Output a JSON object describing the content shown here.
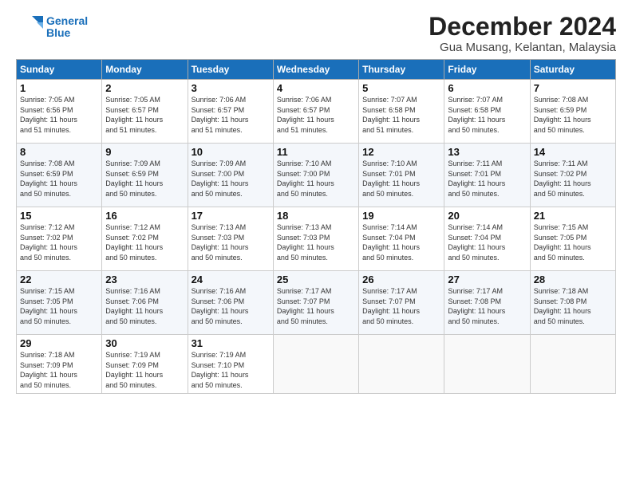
{
  "logo": {
    "text_general": "General",
    "text_blue": "Blue"
  },
  "title": "December 2024",
  "subtitle": "Gua Musang, Kelantan, Malaysia",
  "days_of_week": [
    "Sunday",
    "Monday",
    "Tuesday",
    "Wednesday",
    "Thursday",
    "Friday",
    "Saturday"
  ],
  "weeks": [
    [
      {
        "day": "1",
        "info": "Sunrise: 7:05 AM\nSunset: 6:56 PM\nDaylight: 11 hours\nand 51 minutes."
      },
      {
        "day": "2",
        "info": "Sunrise: 7:05 AM\nSunset: 6:57 PM\nDaylight: 11 hours\nand 51 minutes."
      },
      {
        "day": "3",
        "info": "Sunrise: 7:06 AM\nSunset: 6:57 PM\nDaylight: 11 hours\nand 51 minutes."
      },
      {
        "day": "4",
        "info": "Sunrise: 7:06 AM\nSunset: 6:57 PM\nDaylight: 11 hours\nand 51 minutes."
      },
      {
        "day": "5",
        "info": "Sunrise: 7:07 AM\nSunset: 6:58 PM\nDaylight: 11 hours\nand 51 minutes."
      },
      {
        "day": "6",
        "info": "Sunrise: 7:07 AM\nSunset: 6:58 PM\nDaylight: 11 hours\nand 50 minutes."
      },
      {
        "day": "7",
        "info": "Sunrise: 7:08 AM\nSunset: 6:59 PM\nDaylight: 11 hours\nand 50 minutes."
      }
    ],
    [
      {
        "day": "8",
        "info": "Sunrise: 7:08 AM\nSunset: 6:59 PM\nDaylight: 11 hours\nand 50 minutes."
      },
      {
        "day": "9",
        "info": "Sunrise: 7:09 AM\nSunset: 6:59 PM\nDaylight: 11 hours\nand 50 minutes."
      },
      {
        "day": "10",
        "info": "Sunrise: 7:09 AM\nSunset: 7:00 PM\nDaylight: 11 hours\nand 50 minutes."
      },
      {
        "day": "11",
        "info": "Sunrise: 7:10 AM\nSunset: 7:00 PM\nDaylight: 11 hours\nand 50 minutes."
      },
      {
        "day": "12",
        "info": "Sunrise: 7:10 AM\nSunset: 7:01 PM\nDaylight: 11 hours\nand 50 minutes."
      },
      {
        "day": "13",
        "info": "Sunrise: 7:11 AM\nSunset: 7:01 PM\nDaylight: 11 hours\nand 50 minutes."
      },
      {
        "day": "14",
        "info": "Sunrise: 7:11 AM\nSunset: 7:02 PM\nDaylight: 11 hours\nand 50 minutes."
      }
    ],
    [
      {
        "day": "15",
        "info": "Sunrise: 7:12 AM\nSunset: 7:02 PM\nDaylight: 11 hours\nand 50 minutes."
      },
      {
        "day": "16",
        "info": "Sunrise: 7:12 AM\nSunset: 7:02 PM\nDaylight: 11 hours\nand 50 minutes."
      },
      {
        "day": "17",
        "info": "Sunrise: 7:13 AM\nSunset: 7:03 PM\nDaylight: 11 hours\nand 50 minutes."
      },
      {
        "day": "18",
        "info": "Sunrise: 7:13 AM\nSunset: 7:03 PM\nDaylight: 11 hours\nand 50 minutes."
      },
      {
        "day": "19",
        "info": "Sunrise: 7:14 AM\nSunset: 7:04 PM\nDaylight: 11 hours\nand 50 minutes."
      },
      {
        "day": "20",
        "info": "Sunrise: 7:14 AM\nSunset: 7:04 PM\nDaylight: 11 hours\nand 50 minutes."
      },
      {
        "day": "21",
        "info": "Sunrise: 7:15 AM\nSunset: 7:05 PM\nDaylight: 11 hours\nand 50 minutes."
      }
    ],
    [
      {
        "day": "22",
        "info": "Sunrise: 7:15 AM\nSunset: 7:05 PM\nDaylight: 11 hours\nand 50 minutes."
      },
      {
        "day": "23",
        "info": "Sunrise: 7:16 AM\nSunset: 7:06 PM\nDaylight: 11 hours\nand 50 minutes."
      },
      {
        "day": "24",
        "info": "Sunrise: 7:16 AM\nSunset: 7:06 PM\nDaylight: 11 hours\nand 50 minutes."
      },
      {
        "day": "25",
        "info": "Sunrise: 7:17 AM\nSunset: 7:07 PM\nDaylight: 11 hours\nand 50 minutes."
      },
      {
        "day": "26",
        "info": "Sunrise: 7:17 AM\nSunset: 7:07 PM\nDaylight: 11 hours\nand 50 minutes."
      },
      {
        "day": "27",
        "info": "Sunrise: 7:17 AM\nSunset: 7:08 PM\nDaylight: 11 hours\nand 50 minutes."
      },
      {
        "day": "28",
        "info": "Sunrise: 7:18 AM\nSunset: 7:08 PM\nDaylight: 11 hours\nand 50 minutes."
      }
    ],
    [
      {
        "day": "29",
        "info": "Sunrise: 7:18 AM\nSunset: 7:09 PM\nDaylight: 11 hours\nand 50 minutes."
      },
      {
        "day": "30",
        "info": "Sunrise: 7:19 AM\nSunset: 7:09 PM\nDaylight: 11 hours\nand 50 minutes."
      },
      {
        "day": "31",
        "info": "Sunrise: 7:19 AM\nSunset: 7:10 PM\nDaylight: 11 hours\nand 50 minutes."
      },
      {
        "day": "",
        "info": ""
      },
      {
        "day": "",
        "info": ""
      },
      {
        "day": "",
        "info": ""
      },
      {
        "day": "",
        "info": ""
      }
    ]
  ]
}
